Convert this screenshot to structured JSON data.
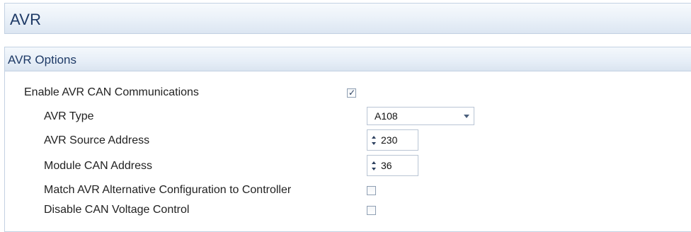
{
  "page": {
    "title": "AVR"
  },
  "panel": {
    "title": "AVR Options"
  },
  "options": {
    "enable_can": {
      "label": "Enable AVR CAN Communications",
      "checked": true
    },
    "avr_type": {
      "label": "AVR Type",
      "value": "A108"
    },
    "avr_source_address": {
      "label": "AVR Source Address",
      "value": "230"
    },
    "module_can_address": {
      "label": "Module CAN Address",
      "value": "36"
    },
    "match_alt_config": {
      "label": "Match AVR Alternative Configuration to Controller",
      "checked": false
    },
    "disable_can_voltage": {
      "label": "Disable CAN Voltage Control",
      "checked": false
    }
  },
  "icons": {
    "checkmark": "check-icon",
    "dropdown": "chevron-down-icon",
    "spin_up": "spin-up-icon",
    "spin_down": "spin-down-icon"
  },
  "colors": {
    "title_text": "#1e3a66",
    "header_gradient_top": "#f7fafd",
    "header_gradient_bottom": "#dce6f2",
    "border": "#c3d1e2"
  }
}
